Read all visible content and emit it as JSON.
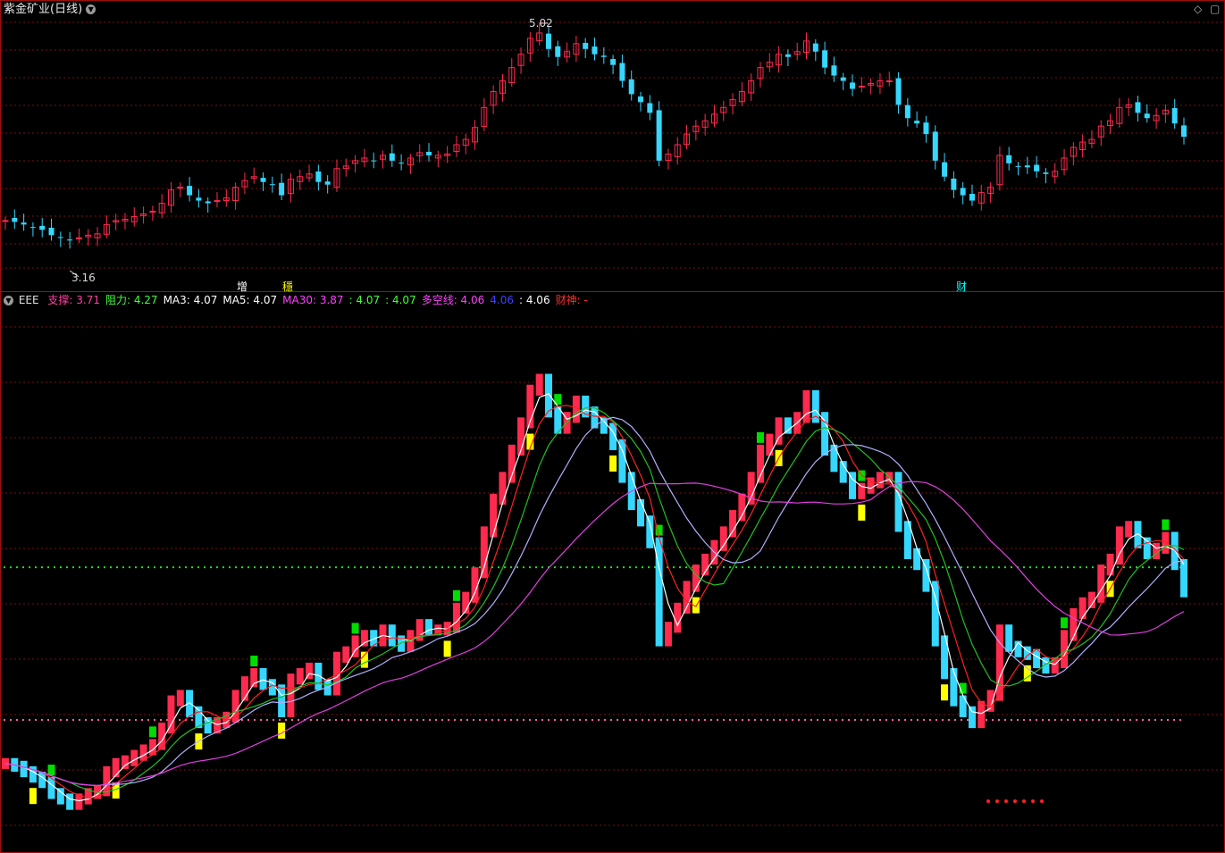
{
  "window": {
    "stock_title": "紫金矿业(日线)",
    "top_right_icons": [
      "diamond-icon",
      "maximize-icon"
    ]
  },
  "price_chart": {
    "high_label": "5.02",
    "low_label": "3.16",
    "markers": [
      {
        "text": "增",
        "color": "#ffffff"
      },
      {
        "text": "穩",
        "color": "#ffff00"
      },
      {
        "text": "财",
        "color": "#00ffff"
      }
    ]
  },
  "indicator": {
    "name": "EEE",
    "items": [
      {
        "label": "支撑: ",
        "value": "3.71",
        "color": "#ff40a0"
      },
      {
        "label": "阻力: ",
        "value": "4.27",
        "color": "#40ff40"
      },
      {
        "label": "MA3: ",
        "value": "4.07",
        "color": "#ffffff"
      },
      {
        "label": "MA5: ",
        "value": "4.07",
        "color": "#ffffff"
      },
      {
        "label": "MA30: ",
        "value": "3.87",
        "color": "#ff40ff"
      },
      {
        "label": ": ",
        "value": "4.07",
        "color": "#40ff40"
      },
      {
        "label": ": ",
        "value": "4.07",
        "color": "#40ff40"
      },
      {
        "label": "多空线: ",
        "value": "4.06",
        "color": "#ff40ff"
      },
      {
        "label": "",
        "value": "4.06",
        "color": "#4040ff"
      },
      {
        "label": ": ",
        "value": "4.06",
        "color": "#ffffff"
      },
      {
        "label": "财神: ",
        "value": "-",
        "color": "#ff3030"
      }
    ]
  },
  "colors": {
    "up": "#ff2a4d",
    "down": "#35d7ff",
    "grid": "#7a1010",
    "frame": "#a01010",
    "ma_white": "#ffffff",
    "ma_red": "#ff2020",
    "ma_magenta": "#e040e0",
    "ma_green": "#20c020",
    "line_blue": "#b0b0ff",
    "signal_green": "#00dd00",
    "signal_yellow": "#ffff00"
  },
  "chart_data": {
    "type": "candlestick",
    "y_top_label": "5.02",
    "y_bottom_label": "3.16",
    "closes": [
      3.55,
      3.54,
      3.52,
      3.5,
      3.48,
      3.44,
      3.42,
      3.4,
      3.42,
      3.44,
      3.45,
      3.52,
      3.55,
      3.56,
      3.58,
      3.6,
      3.62,
      3.68,
      3.78,
      3.8,
      3.74,
      3.7,
      3.68,
      3.7,
      3.72,
      3.8,
      3.85,
      3.88,
      3.84,
      3.82,
      3.74,
      3.86,
      3.88,
      3.9,
      3.84,
      3.82,
      3.94,
      3.96,
      4.0,
      4.02,
      4.0,
      4.04,
      4.0,
      3.98,
      4.02,
      4.06,
      4.04,
      4.04,
      4.05,
      4.12,
      4.16,
      4.25,
      4.4,
      4.52,
      4.6,
      4.7,
      4.8,
      4.92,
      4.96,
      4.84,
      4.78,
      4.82,
      4.88,
      4.84,
      4.8,
      4.78,
      4.72,
      4.6,
      4.5,
      4.44,
      4.36,
      4.0,
      4.05,
      4.12,
      4.2,
      4.26,
      4.3,
      4.35,
      4.4,
      4.46,
      4.52,
      4.6,
      4.7,
      4.74,
      4.8,
      4.78,
      4.82,
      4.9,
      4.82,
      4.7,
      4.64,
      4.6,
      4.54,
      4.56,
      4.58,
      4.6,
      4.6,
      4.42,
      4.32,
      4.28,
      4.2,
      4.0,
      3.88,
      3.78,
      3.74,
      3.7,
      3.76,
      3.8,
      4.04,
      3.98,
      3.96,
      3.95,
      3.92,
      3.9,
      3.92,
      4.02,
      4.1,
      4.14,
      4.16,
      4.26,
      4.3,
      4.4,
      4.42,
      4.36,
      4.32,
      4.34,
      4.38,
      4.28,
      4.18
    ],
    "indicator_lines": [
      "MA3",
      "MA5",
      "MA30",
      "支撑",
      "阻力"
    ]
  }
}
